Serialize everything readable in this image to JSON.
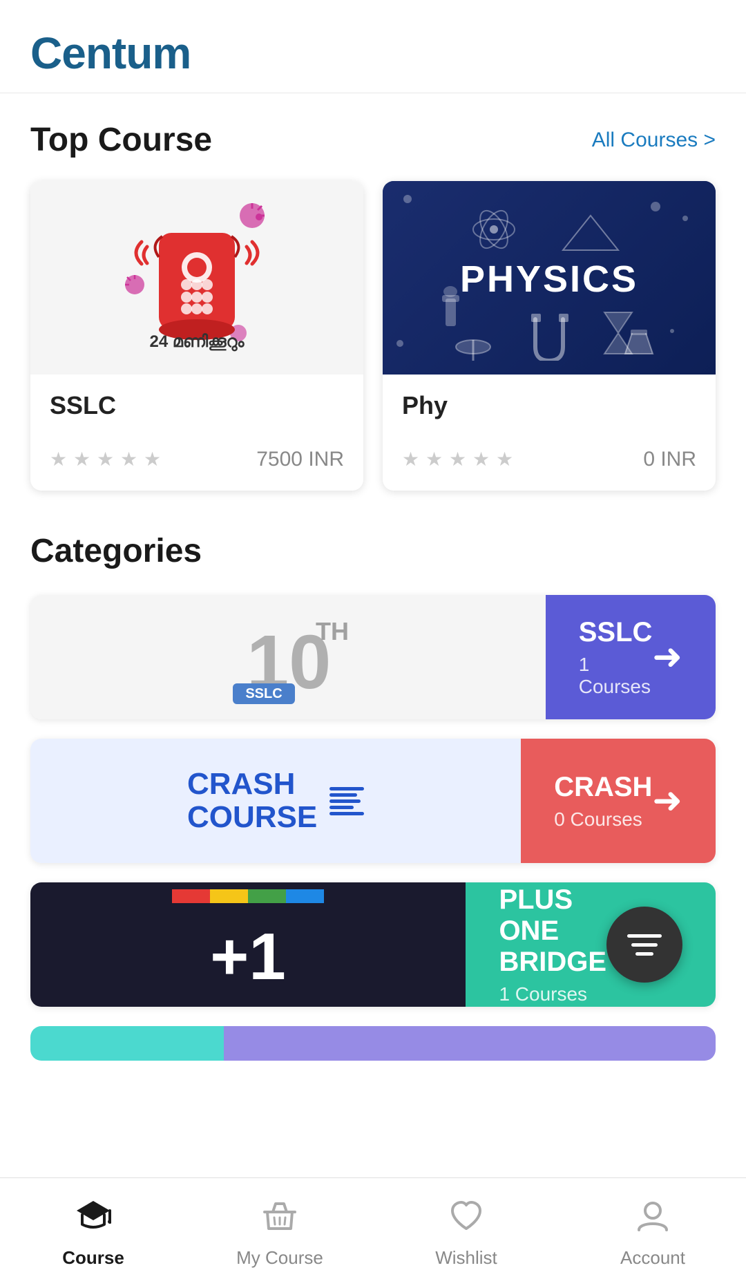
{
  "header": {
    "app_name": "Centum"
  },
  "top_course_section": {
    "title": "Top Course",
    "link_label": "All Courses >"
  },
  "courses": [
    {
      "id": "sslc",
      "name": "SSLC",
      "price": "7500 INR",
      "stars": [
        0,
        0,
        0,
        0,
        0
      ],
      "image_type": "sslc"
    },
    {
      "id": "phy",
      "name": "Phy",
      "price": "0 INR",
      "stars": [
        0,
        0,
        0,
        0,
        0
      ],
      "image_type": "physics"
    }
  ],
  "categories_section": {
    "title": "Categories"
  },
  "categories": [
    {
      "id": "sslc",
      "name": "SSLC",
      "count": "1 Courses",
      "color_class": "cat-sslc",
      "image_type": "sslc-10th"
    },
    {
      "id": "crash",
      "name": "CRASH",
      "count": "0 Courses",
      "color_class": "cat-crash",
      "image_type": "crash-course"
    },
    {
      "id": "plus-one",
      "name": "PLUS ONE BRIDGE",
      "count": "1 Courses",
      "color_class": "cat-plus",
      "image_type": "plus-one"
    }
  ],
  "bottom_nav": {
    "items": [
      {
        "id": "course",
        "label": "Course",
        "active": true
      },
      {
        "id": "my-course",
        "label": "My Course",
        "active": false
      },
      {
        "id": "wishlist",
        "label": "Wishlist",
        "active": false
      },
      {
        "id": "account",
        "label": "Account",
        "active": false
      }
    ]
  }
}
